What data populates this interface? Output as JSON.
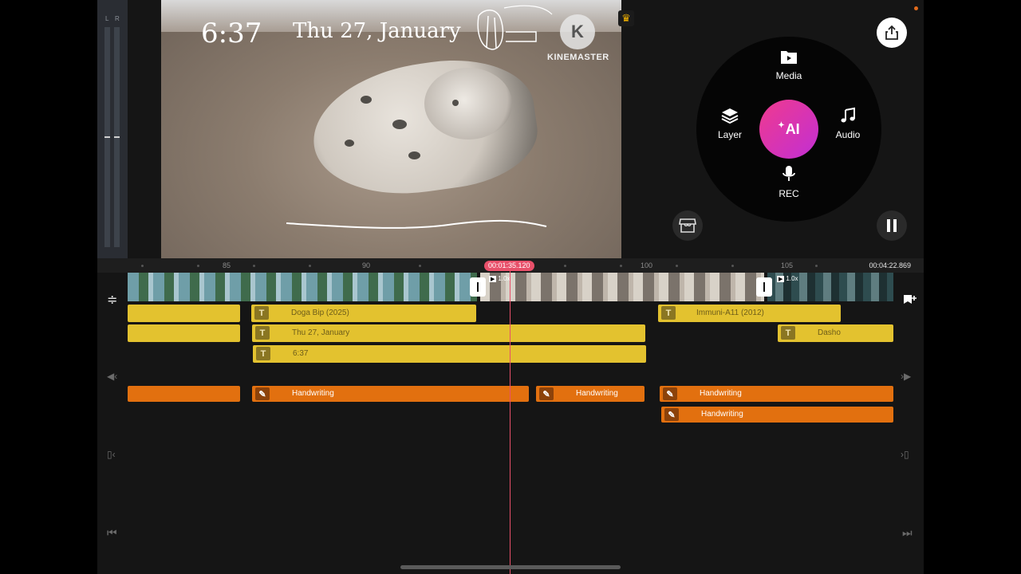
{
  "meter": {
    "left_label": "L",
    "right_label": "R"
  },
  "preview": {
    "time_text": "6:37",
    "date_text": "Thu 27, January",
    "watermark": "KINEMASTER",
    "watermark_logo_letter": "K"
  },
  "radial_menu": {
    "media_label": "Media",
    "layer_label": "Layer",
    "audio_label": "Audio",
    "rec_label": "REC",
    "ai_label": "AI"
  },
  "ruler": {
    "marks": [
      "85",
      "90",
      "100",
      "105"
    ],
    "current_time": "00:01:35.120",
    "end_time": "00:04:22.869"
  },
  "video_track": {
    "clip2_speed": "1.0x",
    "clip3_speed": "1.0x"
  },
  "text_clips": [
    {
      "label": ""
    },
    {
      "label": "Doga Bip (2025)"
    },
    {
      "label": "Immuni-A11 (2012)"
    },
    {
      "label": ""
    },
    {
      "label": "Thu 27, January"
    },
    {
      "label": "Dasho"
    },
    {
      "label": "6:37"
    }
  ],
  "handwriting_clips": [
    {
      "label": ""
    },
    {
      "label": "Handwriting"
    },
    {
      "label": "Handwriting"
    },
    {
      "label": "Handwriting"
    },
    {
      "label": "Handwriting"
    }
  ],
  "colors": {
    "accent": "#e8506a",
    "text_clip": "#e3c22f",
    "handwriting_clip": "#e2700f",
    "ai_gradient_start": "#f03a8e",
    "ai_gradient_end": "#c12fd4"
  }
}
